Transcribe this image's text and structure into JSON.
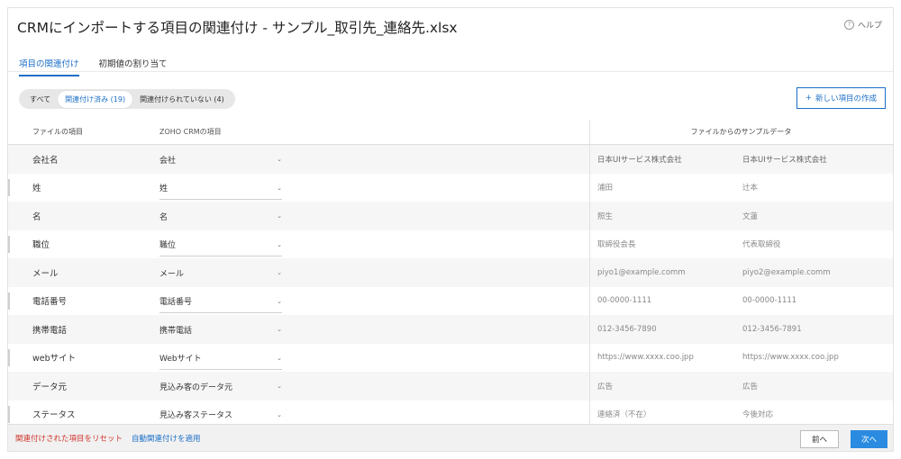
{
  "header": {
    "title": "CRMにインポートする項目の関連付け - サンプル_取引先_連絡先.xlsx",
    "help_label": "ヘルプ",
    "help_icon": "?"
  },
  "tabs": [
    {
      "label": "項目の関連付け",
      "active": true
    },
    {
      "label": "初期値の割り当て",
      "active": false
    }
  ],
  "filters": [
    {
      "label": "すべて",
      "active": false
    },
    {
      "label": "関連付け済み (19)",
      "active": true
    },
    {
      "label": "関連付けられていない (4)",
      "active": false
    }
  ],
  "new_field_button": {
    "icon": "+",
    "label": "新しい項目の作成"
  },
  "table": {
    "headers": {
      "file_field": "ファイルの項目",
      "crm_field": "ZOHO CRMの項目",
      "sample_data": "ファイルからのサンプルデータ"
    },
    "rows": [
      {
        "file": "会社名",
        "crm": "会社",
        "s1": "日本UIサービス株式会社",
        "s2": "日本UIサービス株式会社"
      },
      {
        "file": "姓",
        "crm": "姓",
        "s1": "浦田",
        "s2": "辻本"
      },
      {
        "file": "名",
        "crm": "名",
        "s1": "照生",
        "s2": "文蓮"
      },
      {
        "file": "職位",
        "crm": "職位",
        "s1": "取締役会長",
        "s2": "代表取締役"
      },
      {
        "file": "メール",
        "crm": "メール",
        "s1": "piyo1@example.comm",
        "s2": "piyo2@example.comm"
      },
      {
        "file": "電話番号",
        "crm": "電話番号",
        "s1": "00-0000-1111",
        "s2": "00-0000-1111"
      },
      {
        "file": "携帯電話",
        "crm": "携帯電話",
        "s1": "012-3456-7890",
        "s2": "012-3456-7891"
      },
      {
        "file": "webサイト",
        "crm": "Webサイト",
        "s1": "https://www.xxxx.coo.jpp",
        "s2": "https://www.xxxx.coo.jpp"
      },
      {
        "file": "データ元",
        "crm": "見込み客のデータ元",
        "s1": "広告",
        "s2": "広告"
      },
      {
        "file": "ステータス",
        "crm": "見込み客ステータス",
        "s1": "連絡済（不在）",
        "s2": "今後対応"
      }
    ]
  },
  "footer": {
    "reset_label": "関連付けされた項目をリセット",
    "auto_label": "自動関連付けを適用",
    "prev_label": "前へ",
    "next_label": "次へ"
  },
  "colors": {
    "accent": "#1c6fc7",
    "danger": "#d0342c",
    "primary_button": "#2b8be0"
  }
}
